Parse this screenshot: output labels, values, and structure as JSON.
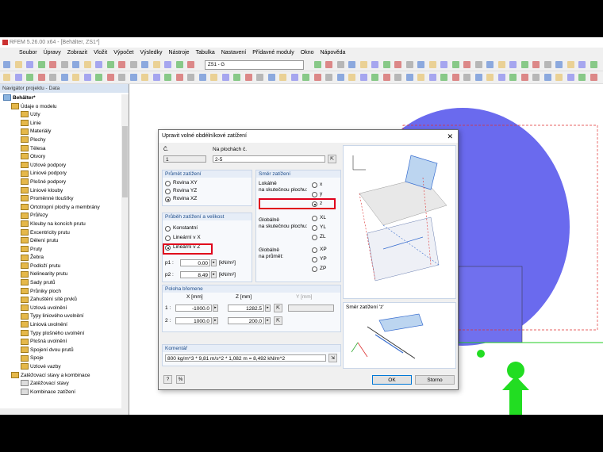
{
  "app": {
    "title": "RFEM 5.26.00 x64 - [Behälter, ZS1*]",
    "menu": [
      "Soubor",
      "Úpravy",
      "Zobrazit",
      "Vložit",
      "Výpočet",
      "Výsledky",
      "Nástroje",
      "Tabulka",
      "Nastavení",
      "Přídavné moduly",
      "Okno",
      "Nápověda"
    ],
    "loadcase_combo": "ZS1 - G"
  },
  "navigator": {
    "title": "Navigátor projektu - Data",
    "root": "Behälter*",
    "model_data": "Údaje o modelu",
    "items": [
      "Uzly",
      "Linie",
      "Materiály",
      "Plochy",
      "Tělesa",
      "Otvory",
      "Uzlové podpory",
      "Liniové podpory",
      "Plošné podpory",
      "Liniové klouby",
      "Proměnné tloušťky",
      "Ortotropní plochy a membrány",
      "Průřezy",
      "Klouby na koncích prutu",
      "Excentricity prutu",
      "Dělení prutu",
      "Pruty",
      "Žebra",
      "Podloží prutu",
      "Nelinearity prutu",
      "Sady prutů",
      "Průniky ploch",
      "Zahuštění sítě prvků",
      "Uzlová uvolnění",
      "Typy liniového uvolnění",
      "Liniová uvolnění",
      "Typy plošného uvolnění",
      "Plošná uvolnění",
      "Spojení dvou prutů",
      "Spoje",
      "Uzlové vazby"
    ],
    "load_group": "Zatěžovací stavy a kombinace",
    "load_items": [
      "Zatěžovací stavy",
      "Kombinace zatížení"
    ]
  },
  "dialog": {
    "title": "Upravit volné obdélníkové zatížení",
    "no_label": "Č.",
    "no_value": "1",
    "surfaces_label": "Na plochách č.",
    "surfaces_value": "2-5",
    "plane_group": "Průmět zatížení",
    "plane_options": [
      "Rovina XY",
      "Rovina YZ",
      "Rovina XZ"
    ],
    "plane_selected": 2,
    "direction_group": "Směr zatížení",
    "local_label": "Lokálně\nna skutečnou plochu:",
    "local_options": [
      "x",
      "y",
      "z"
    ],
    "local_selected": 2,
    "global_label": "Globálně\nna skutečnou plochu:",
    "global_options": [
      "XL",
      "YL",
      "ZL"
    ],
    "projected_label": "Globálně\nna průmět:",
    "projected_options": [
      "XP",
      "YP",
      "ZP"
    ],
    "dist_group": "Průběh zatížení a velikost",
    "dist_options": [
      "Konstantní",
      "Lineární v X",
      "Lineární v Z"
    ],
    "dist_selected": 2,
    "p1_label": "p1 :",
    "p1_value": "0.00",
    "p2_label": "p2 :",
    "p2_value": "8.49",
    "unit": "[kN/m²]",
    "position_group": "Poloha břemene",
    "col_x": "X  [mm]",
    "col_z": "Z  [mm]",
    "col_y": "Y  [mm]",
    "rows": [
      {
        "n": "1 :",
        "x": "-1000.0",
        "z": "1282.5"
      },
      {
        "n": "2 :",
        "x": "1000.0",
        "z": "200.0"
      }
    ],
    "comment_group": "Komentář",
    "comment_value": "800 kg/m^3 * 9,81 m/s^2 * 1,082 m = 8,492 kN/m^2",
    "preview_caption": "Směr zatížení 'z'",
    "ok": "OK",
    "cancel": "Storno"
  },
  "colors": {
    "accent": "#0078d7",
    "highlight": "#e0001b",
    "model_blue": "#6666ee",
    "support_green": "#22dd22"
  }
}
